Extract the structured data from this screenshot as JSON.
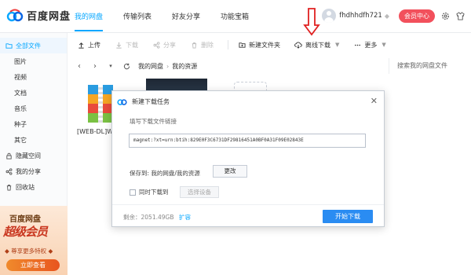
{
  "app": {
    "logo_text": "百度网盘",
    "colors": {
      "accent": "#06a7ff",
      "member": "#f2505c",
      "primary_button": "#2a8cf2",
      "arrow": "#e02020"
    }
  },
  "nav": {
    "tabs": [
      {
        "label": "我的网盘",
        "active": true
      },
      {
        "label": "传输列表",
        "active": false
      },
      {
        "label": "好友分享",
        "active": false
      },
      {
        "label": "功能宝箱",
        "active": false
      }
    ]
  },
  "user": {
    "name": "fhdhhdfh721",
    "member_label": "会员中心",
    "icons": [
      "avatar",
      "vip-diamond-icon",
      "gear-icon",
      "skin-icon"
    ]
  },
  "sidebar": {
    "items": [
      {
        "label": "全部文件",
        "icon": "folder-icon",
        "active": true
      },
      {
        "label": "图片",
        "sub": true
      },
      {
        "label": "视频",
        "sub": true
      },
      {
        "label": "文档",
        "sub": true
      },
      {
        "label": "音乐",
        "sub": true
      },
      {
        "label": "种子",
        "sub": true
      },
      {
        "label": "其它",
        "sub": true
      },
      {
        "label": "隐藏空间",
        "icon": "lock-icon"
      },
      {
        "label": "我的分享",
        "icon": "share-icon"
      },
      {
        "label": "回收站",
        "icon": "trash-icon"
      }
    ],
    "promo": {
      "title": "百度网盘",
      "headline": "超级会员",
      "sub": "◆ 尊享更多特权 ◆",
      "button": "立即查看"
    }
  },
  "toolbar": {
    "upload": "上传",
    "download": "下载",
    "share": "分享",
    "delete": "删除",
    "new_folder": "新建文件夹",
    "offline_download": "离线下载",
    "more": "更多"
  },
  "path": {
    "crumbs": [
      "我的网盘",
      "我的资源"
    ],
    "search_placeholder": "搜索我的网盘文件"
  },
  "files": {
    "first_name": "[WEB-DL]W"
  },
  "dialog": {
    "title": "新建下载任务",
    "link_label": "填写下载文件链接",
    "link_value": "magnet:?xt=urn:btih:829E0F3C6731DF29816451A0BF0A31F09E02843E",
    "save_to_label": "保存到: 我的网盘/我的资源",
    "change_button": "更改",
    "checkbox_label": "同时下载到",
    "device_button": "选择设备",
    "remaining": "剩余：2051.49GB",
    "expand": "扩容",
    "start_button": "开始下载"
  }
}
